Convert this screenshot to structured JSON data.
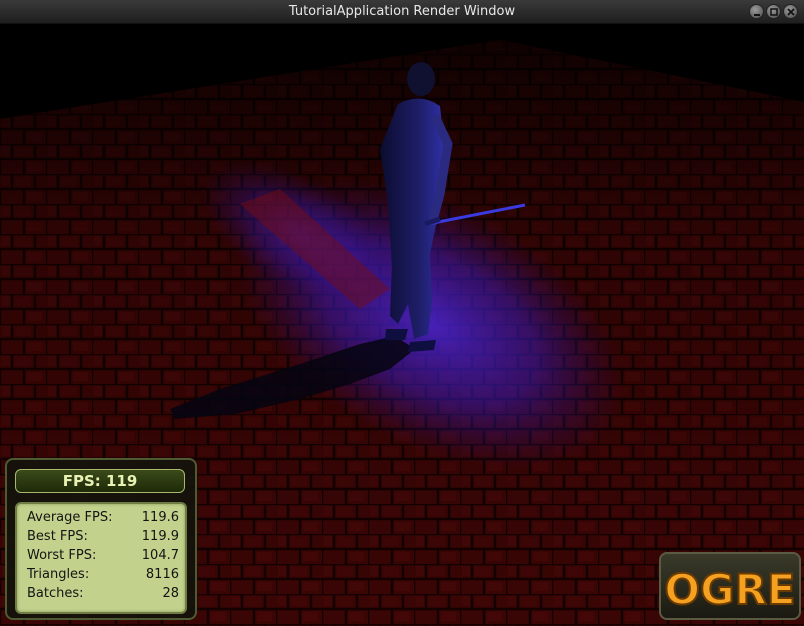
{
  "window": {
    "title": "TutorialApplication Render Window"
  },
  "titlebar_buttons": [
    {
      "icon": "minimize-icon"
    },
    {
      "icon": "maximize-icon"
    },
    {
      "icon": "close-icon"
    }
  ],
  "stats": {
    "fps_label": "FPS:",
    "fps_value": "119",
    "rows": [
      {
        "label": "Average FPS:",
        "value": "119.6"
      },
      {
        "label": "Best FPS:",
        "value": "119.9"
      },
      {
        "label": "Worst FPS:",
        "value": "104.7"
      },
      {
        "label": "Triangles:",
        "value": "8116"
      },
      {
        "label": "Batches:",
        "value": "28"
      }
    ]
  },
  "logo": {
    "text": "OGRE"
  },
  "colors": {
    "floor": "#3a0606",
    "spotlight": "#3b1aa0",
    "ninja": "#1a1a5a",
    "panel_green": "#c2d28d"
  }
}
